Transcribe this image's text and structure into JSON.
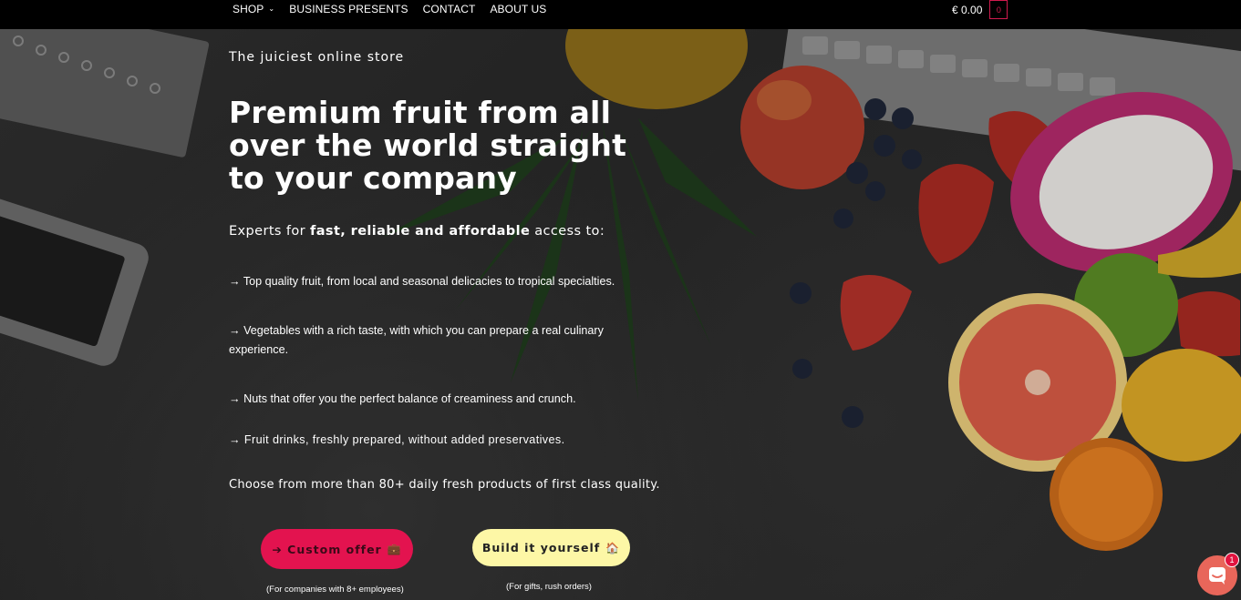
{
  "nav": {
    "items": [
      {
        "label": "SHOP",
        "has_dropdown": true
      },
      {
        "label": "BUSINESS PRESENTS",
        "has_dropdown": false
      },
      {
        "label": "CONTACT",
        "has_dropdown": false
      },
      {
        "label": "ABOUT US",
        "has_dropdown": false
      }
    ],
    "cart_total": "€ 0.00",
    "cart_count": "0"
  },
  "hero": {
    "tagline": "The juiciest online store",
    "headline": "Premium fruit from all over the world straight to your company",
    "intro_prefix": "Experts for",
    "intro_bold": "fast, reliable and affordable",
    "intro_suffix": "access to:",
    "bullets": [
      "→ Top quality fruit, from local and seasonal delicacies to tropical specialties.",
      "→ Vegetables with a rich taste, with which you can prepare a real culinary experience.",
      "→ Nuts that offer you the perfect balance of creaminess and crunch.",
      "→ Fruit drinks, freshly prepared, without added preservatives."
    ],
    "choose_text": "Choose from more than 80+ daily fresh products of first class quality."
  },
  "buttons": {
    "custom_offer": {
      "label": "➔ Custom offer",
      "emoji": "💼",
      "note": "(For companies with 8+ employees)"
    },
    "build_yourself": {
      "label": "Build it yourself",
      "emoji": "🏠",
      "note": "(For gifts, rush orders)"
    }
  },
  "chat": {
    "badge": "1",
    "icon": "chat-bubble-icon"
  },
  "colors": {
    "accent_pink": "#e3134f",
    "accent_yellow": "#fdf7a6",
    "nav_bg": "#000000",
    "chat_orange": "#e8665a"
  }
}
